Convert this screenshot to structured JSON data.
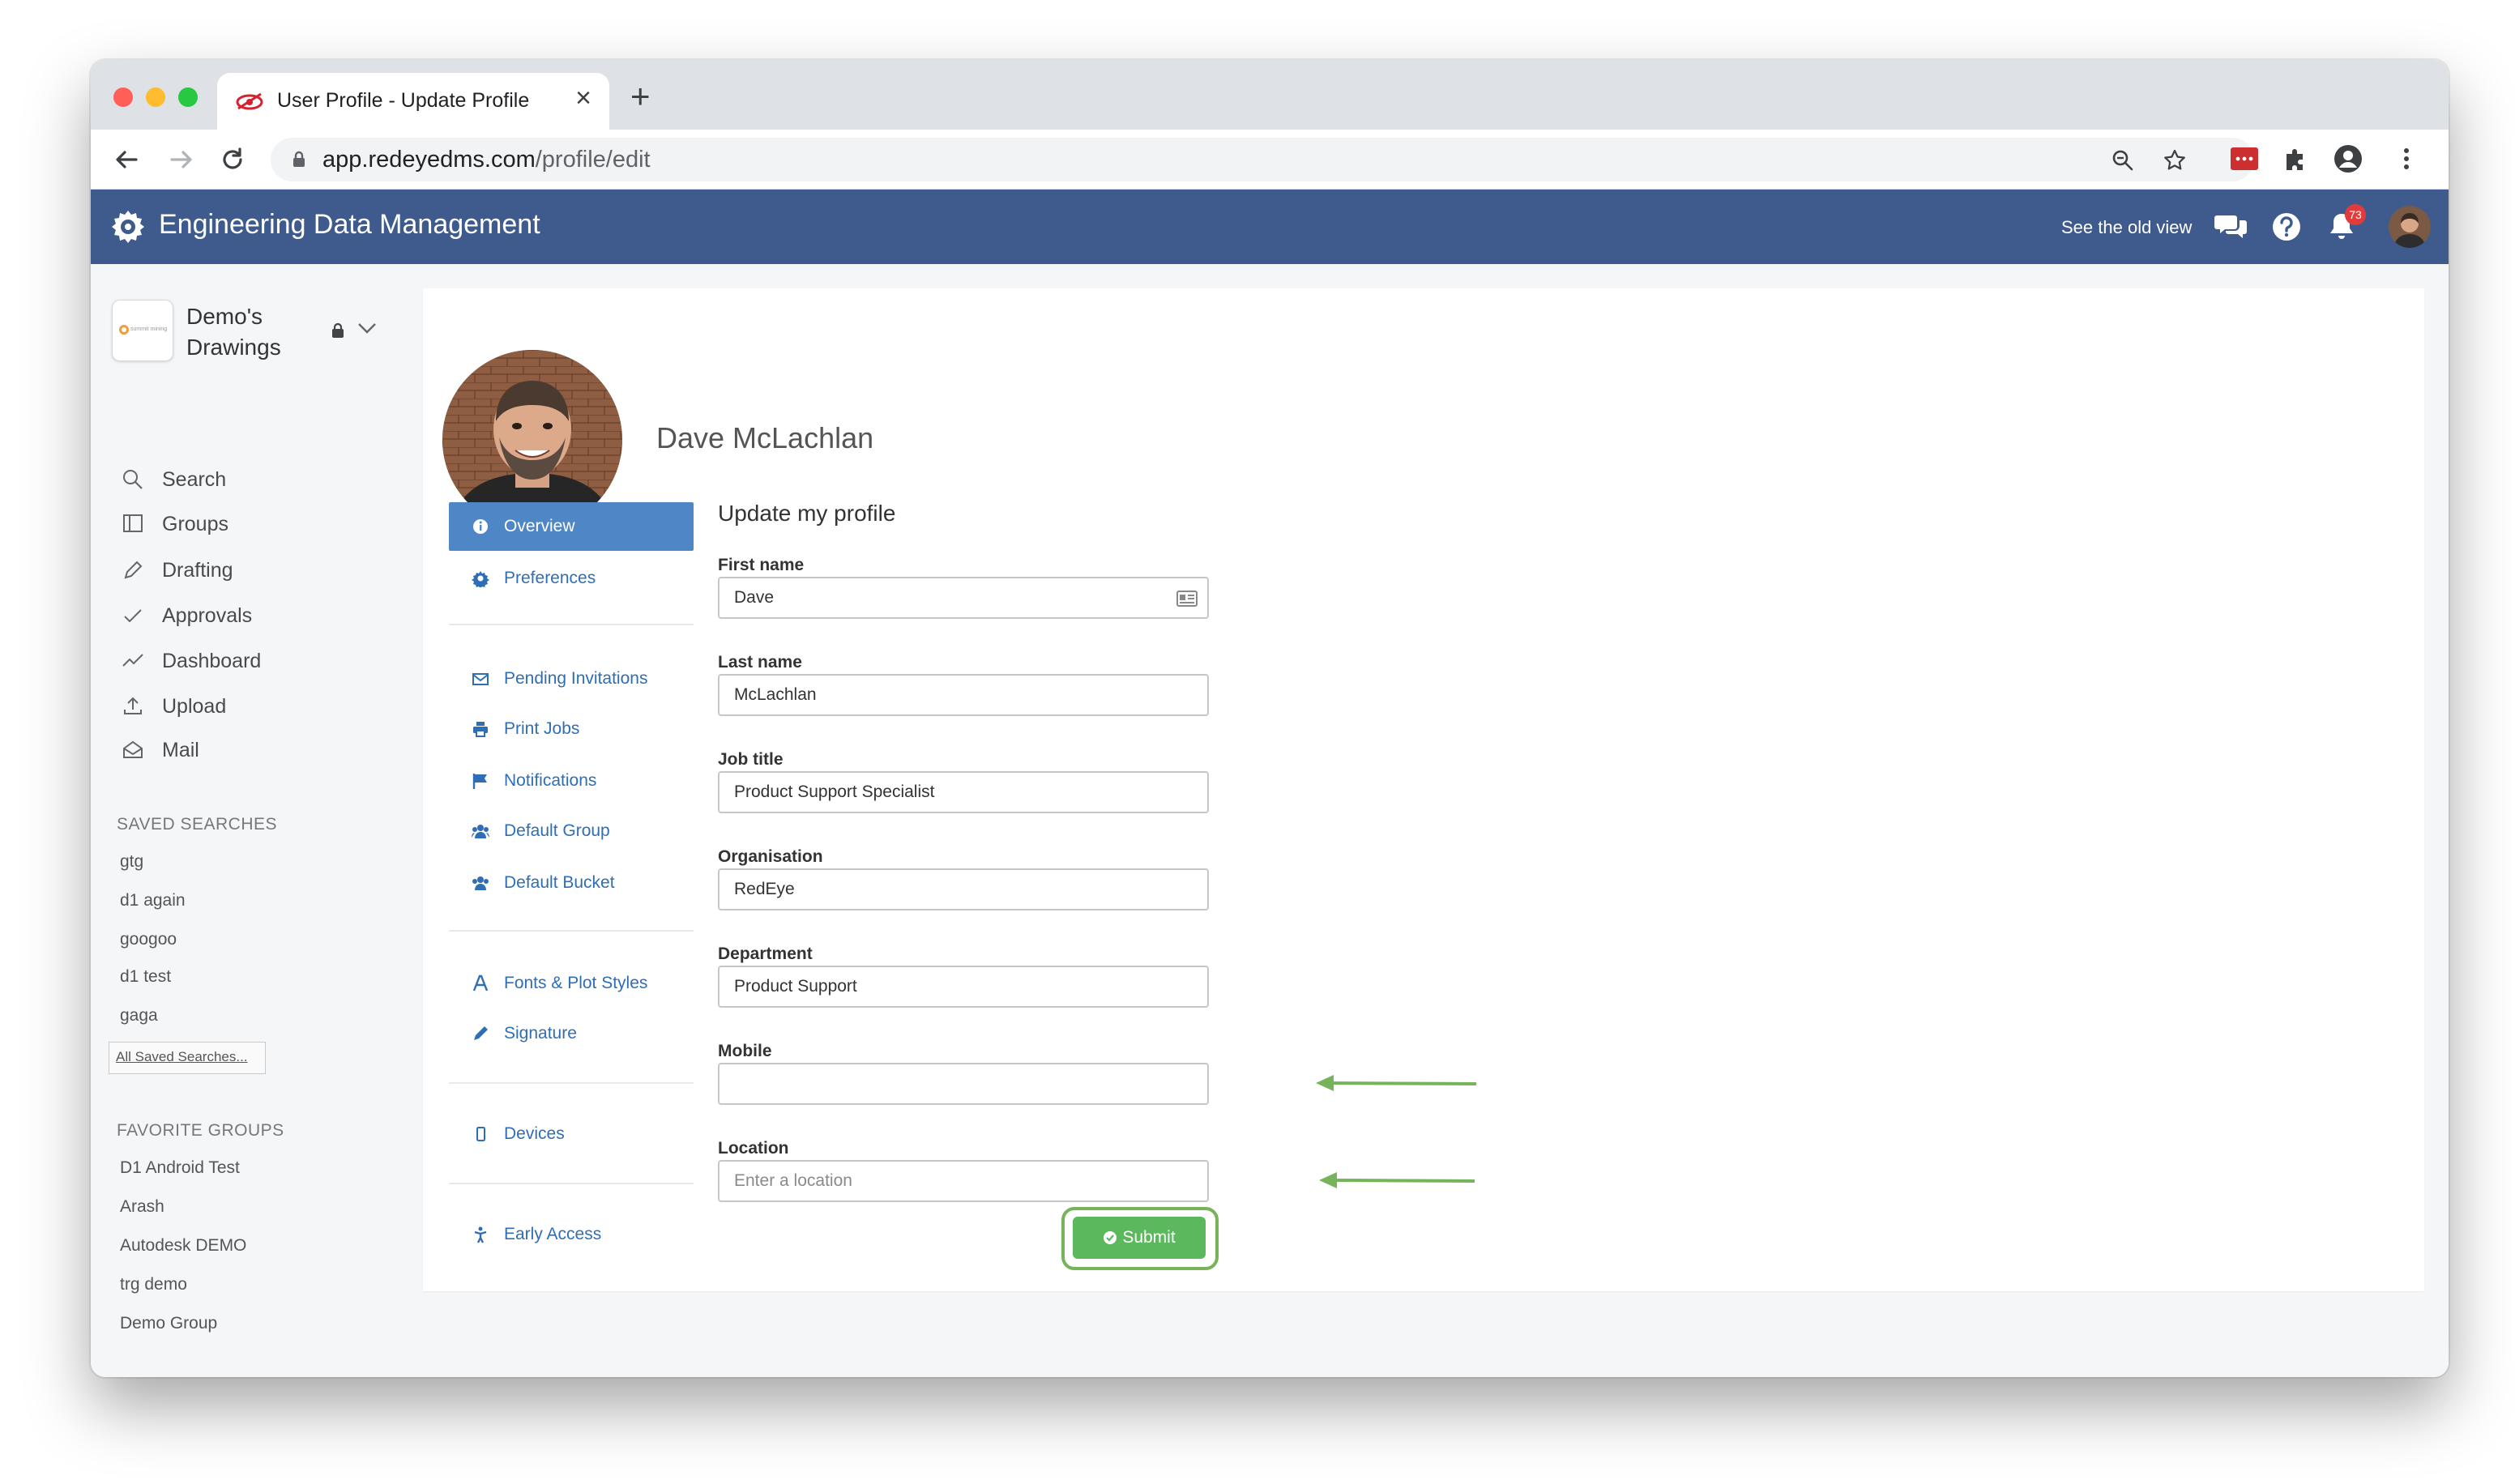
{
  "browser": {
    "tab_title": "User Profile - Update Profile",
    "new_tab_label": "+",
    "close_label": "×",
    "url_host": "app.redeyedms.com",
    "url_path": "/profile/edit"
  },
  "app": {
    "title": "Engineering Data Management",
    "old_view_link": "See the old view",
    "notification_count": "73"
  },
  "workspace": {
    "name": "Demo's Drawings",
    "logo_text": "summit mining"
  },
  "sidebar": {
    "nav": [
      {
        "label": "Search",
        "icon": "search-icon"
      },
      {
        "label": "Groups",
        "icon": "groups-icon"
      },
      {
        "label": "Drafting",
        "icon": "pencil-icon"
      },
      {
        "label": "Approvals",
        "icon": "check-icon"
      },
      {
        "label": "Dashboard",
        "icon": "chart-line-icon"
      },
      {
        "label": "Upload",
        "icon": "upload-icon"
      },
      {
        "label": "Mail",
        "icon": "mail-icon"
      }
    ],
    "saved_searches_title": "SAVED SEARCHES",
    "saved_searches": [
      "gtg",
      "d1 again",
      "googoo",
      "d1 test",
      "gaga"
    ],
    "all_saved_searches": "All Saved Searches...",
    "favorite_groups_title": "FAVORITE GROUPS",
    "favorite_groups": [
      "D1 Android Test",
      "Arash",
      "Autodesk DEMO",
      "trg demo",
      "Demo Group"
    ]
  },
  "profile": {
    "name": "Dave McLachlan",
    "menu": [
      {
        "label": "Overview",
        "icon": "info-icon",
        "active": true
      },
      {
        "label": "Preferences",
        "icon": "gear-icon"
      },
      {
        "label": "Pending Invitations",
        "icon": "envelope-icon"
      },
      {
        "label": "Print Jobs",
        "icon": "printer-icon"
      },
      {
        "label": "Notifications",
        "icon": "flag-icon"
      },
      {
        "label": "Default Group",
        "icon": "users-icon"
      },
      {
        "label": "Default Bucket",
        "icon": "users-icon"
      },
      {
        "label": "Fonts & Plot Styles",
        "icon": "font-icon"
      },
      {
        "label": "Signature",
        "icon": "pen-icon"
      },
      {
        "label": "Devices",
        "icon": "mobile-icon"
      },
      {
        "label": "Early Access",
        "icon": "figure-icon"
      }
    ]
  },
  "form": {
    "title": "Update my profile",
    "first_name": {
      "label": "First name",
      "value": "Dave"
    },
    "last_name": {
      "label": "Last name",
      "value": "McLachlan"
    },
    "job_title": {
      "label": "Job title",
      "value": "Product Support Specialist"
    },
    "organisation": {
      "label": "Organisation",
      "value": "RedEye"
    },
    "department": {
      "label": "Department",
      "value": "Product Support"
    },
    "mobile": {
      "label": "Mobile",
      "value": ""
    },
    "location": {
      "label": "Location",
      "value": "",
      "placeholder": "Enter a location"
    },
    "submit_label": "Submit"
  },
  "colors": {
    "app_header": "#3f5a8c",
    "active_menu": "#4f86c6",
    "link": "#2f6eb5",
    "submit": "#5cb85c",
    "annotation": "#76b35a"
  }
}
